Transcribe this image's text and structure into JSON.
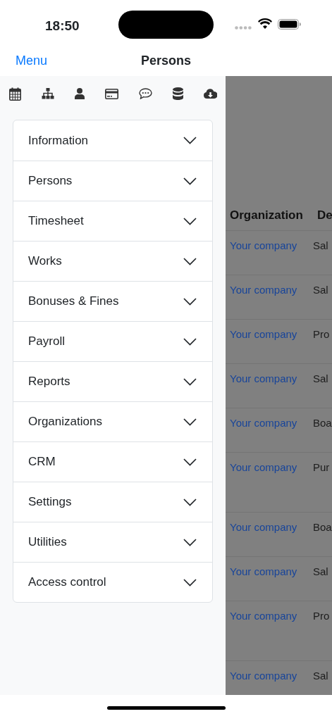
{
  "status_bar": {
    "time": "18:50"
  },
  "nav_bar": {
    "back": "Menu",
    "title": "Persons"
  },
  "toolbar": [
    {
      "kind": "calendar"
    },
    {
      "kind": "sitemap"
    },
    {
      "kind": "user"
    },
    {
      "kind": "card"
    },
    {
      "kind": "chat"
    },
    {
      "kind": "database"
    },
    {
      "kind": "cloud"
    }
  ],
  "menu": [
    {
      "label": "Information",
      "expanded": false
    },
    {
      "label": "Persons",
      "expanded": false
    },
    {
      "label": "Timesheet",
      "expanded": false
    },
    {
      "label": "Works",
      "expanded": false
    },
    {
      "label": "Bonuses & Fines",
      "expanded": false
    },
    {
      "label": "Payroll",
      "expanded": false
    },
    {
      "label": "Reports",
      "expanded": false
    },
    {
      "label": "Organizations",
      "expanded": false
    },
    {
      "label": "CRM",
      "expanded": false
    },
    {
      "label": "Settings",
      "expanded": false
    },
    {
      "label": "Utilities",
      "expanded": false
    },
    {
      "label": "Access control",
      "expanded": false
    }
  ],
  "table": {
    "columns": [
      "Organization",
      "De"
    ],
    "rows": [
      {
        "organization": "Your company",
        "column_2": "Sal",
        "tall": false
      },
      {
        "organization": "Your company",
        "column_2": "Sal",
        "tall": false
      },
      {
        "organization": "Your company",
        "column_2": "Pro",
        "tall": false
      },
      {
        "organization": "Your company",
        "column_2": "Sal",
        "tall": false
      },
      {
        "organization": "Your company",
        "column_2": "Boa",
        "tall": false
      },
      {
        "organization": "Your company",
        "column_2": "Pur",
        "tall": true
      },
      {
        "organization": "Your company",
        "column_2": "Boa",
        "tall": false
      },
      {
        "organization": "Your company",
        "column_2": "Sal",
        "tall": false
      },
      {
        "organization": "Your company",
        "column_2": "Pro",
        "tall": true
      },
      {
        "organization": "Your company",
        "column_2": "Sal",
        "tall": false
      }
    ]
  }
}
